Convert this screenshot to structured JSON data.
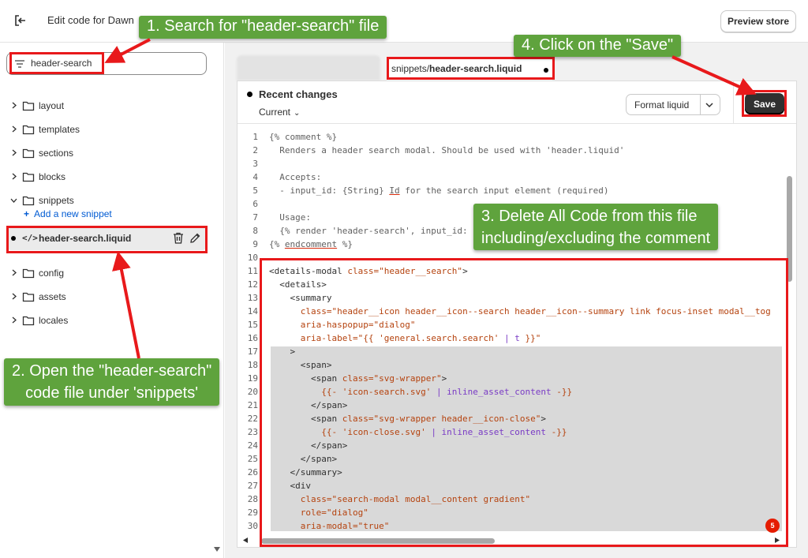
{
  "topbar": {
    "title": "Edit code for Dawn",
    "preview_label": "Preview store"
  },
  "sidebar": {
    "search_value": "header-search",
    "folders": [
      {
        "label": "layout",
        "expanded": false
      },
      {
        "label": "templates",
        "expanded": false
      },
      {
        "label": "sections",
        "expanded": false
      },
      {
        "label": "blocks",
        "expanded": false
      },
      {
        "label": "snippets",
        "expanded": true
      },
      {
        "label": "config",
        "expanded": false
      },
      {
        "label": "assets",
        "expanded": false
      },
      {
        "label": "locales",
        "expanded": false
      }
    ],
    "add_snippet_label": "Add a new snippet",
    "active_file": "header-search.liquid"
  },
  "editor": {
    "tab": {
      "prefix": "snippets/",
      "file": "header-search.liquid"
    },
    "recent_changes_label": "Recent changes",
    "current_label": "Current",
    "format_label": "Format liquid",
    "save_label": "Save",
    "badge_count": "5",
    "lines": [
      {
        "n": "1",
        "html": "<span class=\"cm\">{% comment %}</span>"
      },
      {
        "n": "2",
        "html": "<span class=\"cm\">  Renders a header search modal. Should be used with 'header.liquid'</span>"
      },
      {
        "n": "3",
        "html": ""
      },
      {
        "n": "4",
        "html": "<span class=\"cm\">  Accepts:</span>"
      },
      {
        "n": "5",
        "html": "<span class=\"cm\">  - input_id: {String} <span class=\"hl-red\">Id</span> for the search input element (required)</span>"
      },
      {
        "n": "6",
        "html": ""
      },
      {
        "n": "7",
        "html": "<span class=\"cm\">  Usage:</span>"
      },
      {
        "n": "8",
        "html": "<span class=\"cm\">  {% render 'header-search', input_id:</span>"
      },
      {
        "n": "9",
        "html": "<span class=\"cm\">{% <span class=\"hl-red\">endcomment</span> %}</span>"
      },
      {
        "n": "10",
        "html": ""
      },
      {
        "n": "11",
        "html": "<span class=\"tag\">&lt;details-modal </span><span class=\"attr\">class=</span><span class=\"str\">\"header__search\"</span><span class=\"tag\">&gt;</span>"
      },
      {
        "n": "12",
        "html": "<span class=\"tag\">  &lt;details&gt;</span>"
      },
      {
        "n": "13",
        "html": "<span class=\"tag\">    &lt;summary</span>"
      },
      {
        "n": "14",
        "html": "      <span class=\"attr\">class=</span><span class=\"str\">\"header__icon header__icon--search header__icon--summary link focus-inset modal__tog</span>"
      },
      {
        "n": "15",
        "html": "      <span class=\"attr\">aria-haspopup=</span><span class=\"str\">\"dialog\"</span>"
      },
      {
        "n": "16",
        "html": "      <span class=\"attr\">aria-label=</span><span class=\"str\">\"{{ 'general.search.search' </span><span class=\"flt\">| t</span><span class=\"str\"> }}\"</span>"
      },
      {
        "n": "17",
        "html": "<span class=\"tag\">    &gt;</span>"
      },
      {
        "n": "18",
        "html": "<span class=\"tag\">      &lt;span&gt;</span>"
      },
      {
        "n": "19",
        "html": "<span class=\"tag\">        &lt;span </span><span class=\"attr\">class=</span><span class=\"str\">\"svg-wrapper\"</span><span class=\"tag\">&gt;</span>"
      },
      {
        "n": "20",
        "html": "          <span class=\"str\">{{- 'icon-search.svg' </span><span class=\"flt\">| inline_asset_content</span><span class=\"str\"> -}}</span>"
      },
      {
        "n": "21",
        "html": "<span class=\"tag\">        &lt;/span&gt;</span>"
      },
      {
        "n": "22",
        "html": "<span class=\"tag\">        &lt;span </span><span class=\"attr\">class=</span><span class=\"str\">\"svg-wrapper header__icon-close\"</span><span class=\"tag\">&gt;</span>"
      },
      {
        "n": "23",
        "html": "          <span class=\"str\">{{- 'icon-close.svg' </span><span class=\"flt\">| inline_asset_content</span><span class=\"str\"> -}}</span>"
      },
      {
        "n": "24",
        "html": "<span class=\"tag\">        &lt;/span&gt;</span>"
      },
      {
        "n": "25",
        "html": "<span class=\"tag\">      &lt;/span&gt;</span>"
      },
      {
        "n": "26",
        "html": "<span class=\"tag\">    &lt;/summary&gt;</span>"
      },
      {
        "n": "27",
        "html": "<span class=\"tag\">    &lt;div</span>"
      },
      {
        "n": "28",
        "html": "      <span class=\"attr\">class=</span><span class=\"str\">\"search-modal modal__content gradient\"</span>"
      },
      {
        "n": "29",
        "html": "      <span class=\"attr\">role=</span><span class=\"str\">\"dialog\"</span>"
      },
      {
        "n": "30",
        "html": "      <span class=\"attr\">aria-modal=</span><span class=\"str\">\"true\"</span>"
      }
    ]
  },
  "annotations": {
    "step1": "1. Search for \"header-search\" file",
    "step2_line1": "2. Open the \"header-search\"",
    "step2_line2": "code file under 'snippets'",
    "step3_line1": "3. Delete All Code from this file",
    "step3_line2": "including/excluding the comment",
    "step4": "4. Click on the \"Save\"",
    "callout_color": "#5fa33d",
    "highlight_color": "#e8191b"
  }
}
